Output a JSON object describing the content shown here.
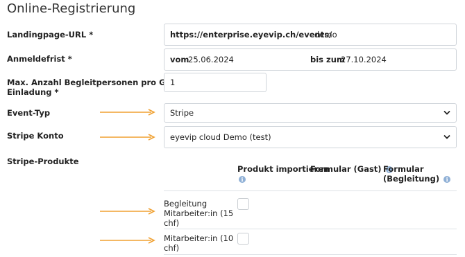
{
  "page": {
    "title": "Online-Registrierung"
  },
  "fields": {
    "landing": {
      "label": "Landingpage-URL *",
      "prefix": "https://enterprise.eyevip.ch/events/",
      "value": "demo"
    },
    "deadline": {
      "label": "Anmeldefrist *",
      "from_label": "vom",
      "from_value": "25.06.2024",
      "to_label": "bis zum",
      "to_value": "27.10.2024"
    },
    "companions": {
      "label_line1": "Max. Anzahl Begleitpersonen pro Gast mit",
      "label_line2": "Einladung *",
      "value": "1"
    },
    "event_type": {
      "label": "Event-Typ",
      "value": "Stripe"
    },
    "stripe_account": {
      "label": "Stripe Konto",
      "value": "eyevip cloud Demo (test)"
    }
  },
  "products": {
    "label": "Stripe-Produkte",
    "headers": {
      "import": "Produkt importieren",
      "form_guest": "Formular (Gast)",
      "form_companion_line1": "Formular",
      "form_companion_line2": "(Begleitung)"
    },
    "rows": [
      {
        "line1": "Begleitung",
        "line2": "Mitarbeiter:in (15",
        "line3": "chf)"
      },
      {
        "line1": "Mitarbeiter:in (10",
        "line2": "chf)"
      }
    ]
  },
  "icons": {
    "info": "info-icon",
    "caret": "chevron-down-icon",
    "arrow": "arrow-right-icon"
  },
  "colors": {
    "arrow": "#f0a030",
    "info": "#8fb0d6",
    "border": "#cfd4da"
  }
}
